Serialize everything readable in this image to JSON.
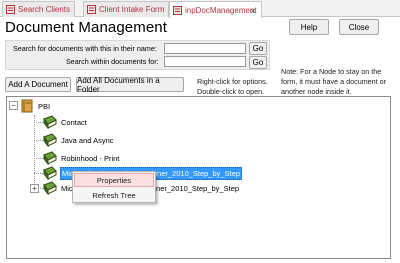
{
  "tabs": [
    {
      "label": "Search Clients",
      "active": false
    },
    {
      "label": "Client Intake Form",
      "active": false
    },
    {
      "label": "inpDocManagement",
      "active": true
    }
  ],
  "tab_close_glyph": "×",
  "page_title": "Document Management",
  "header_buttons": {
    "help": "Help",
    "close": "Close"
  },
  "search": {
    "name_label": "Search for documents with this in their name:",
    "name_value": "",
    "within_label": "Search within documents for:",
    "within_value": "",
    "go_label": "Go"
  },
  "actions": {
    "add_document": "Add A Document",
    "add_all_in_folder": "Add All Documents in a Folder"
  },
  "hint": {
    "line1": "Right-click for options.",
    "line2": "Double-click to open."
  },
  "note": {
    "line1": "Note: For a Node to stay on the",
    "line2": "form, it must have a document or",
    "line3": "another node inside it."
  },
  "tree": {
    "root": {
      "label": "PBI",
      "expanded": true,
      "toggle": "−"
    },
    "children": [
      {
        "label": "Contact",
        "selected": false
      },
      {
        "label": "Java and Async",
        "selected": false
      },
      {
        "label": "Robinhood - Print",
        "selected": false
      },
      {
        "label": "Microsoft_SharePoint_Designer_2010_Step_by_Step",
        "selected": true
      },
      {
        "label": "Microsoft_SharePoint_Designer_2010_Step_by_Step",
        "selected": false,
        "toggle": "+"
      }
    ]
  },
  "context_menu": {
    "items": [
      {
        "label": "Properties",
        "hover": true
      },
      {
        "label": "Refresh Tree",
        "hover": false
      }
    ]
  },
  "colors": {
    "tab_text": "#b0343c",
    "selection": "#3399ff",
    "menu_hover": "#fbe0e2",
    "book": "#3e6b1f"
  }
}
